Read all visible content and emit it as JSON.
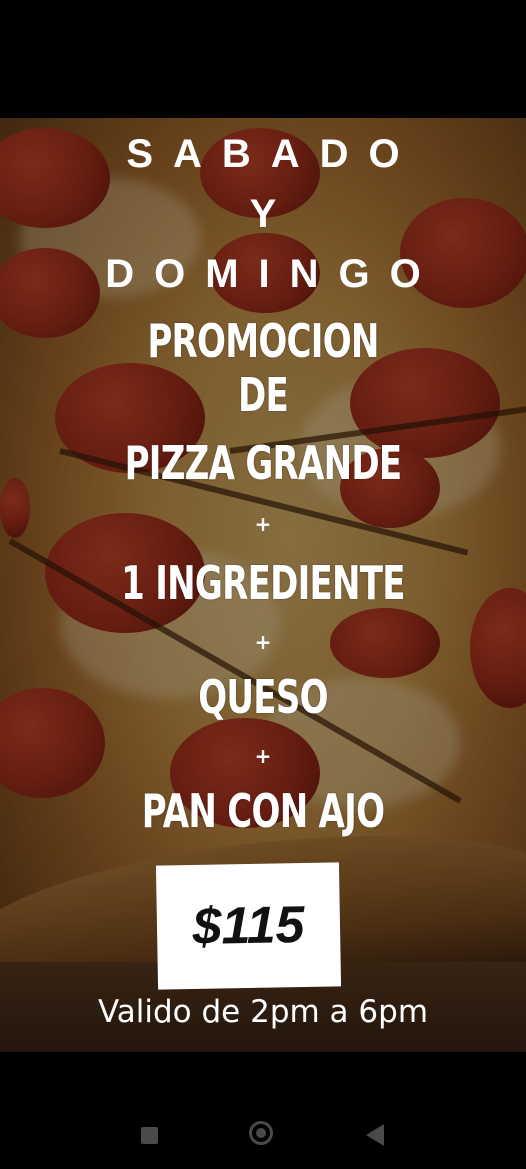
{
  "flyer": {
    "line1": "SABADO",
    "line2": "Y",
    "line3": "DOMINGO",
    "line4": "PROMOCION",
    "line5": "DE",
    "line6": "PIZZA GRANDE",
    "plus1": "+",
    "line7": "1 INGREDIENTE",
    "plus2": "+",
    "line8": "QUESO",
    "plus3": "+",
    "line9": "PAN CON AJO",
    "price": "$115",
    "validity": "Valido de 2pm a 6pm"
  },
  "navigation": {
    "recents": "recents-square-icon",
    "home": "home-circle-icon",
    "back": "back-triangle-icon"
  },
  "colors": {
    "background": "#000000",
    "text": "#ffffff",
    "price_box": "#ffffff",
    "price_text": "#111111",
    "nav_icon": "#4a4a4a"
  }
}
